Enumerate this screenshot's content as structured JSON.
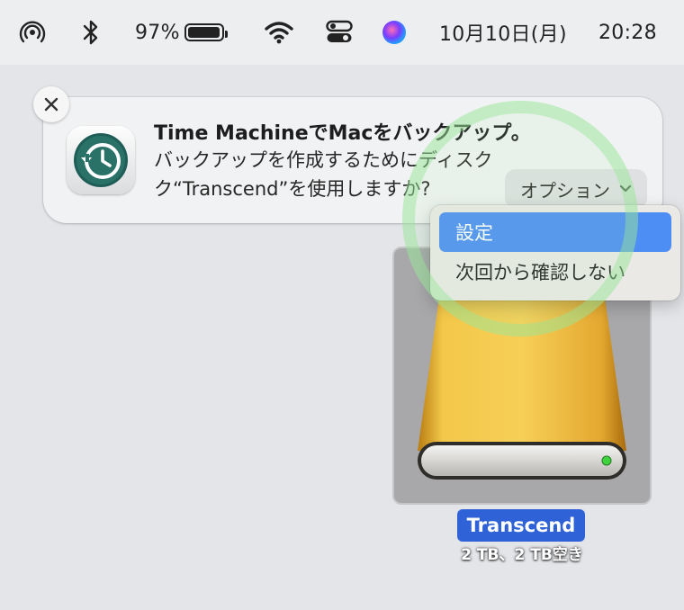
{
  "menubar": {
    "battery_percent": "97%",
    "battery_level": 0.97,
    "date": "10月10日(月)",
    "time": "20:28",
    "icons": [
      "airdrop-icon",
      "bluetooth-icon",
      "battery-icon",
      "wifi-icon",
      "control-center-icon",
      "siri-icon"
    ]
  },
  "notification": {
    "app_icon": "time-machine-icon",
    "title": "Time MachineでMacをバックアップ。",
    "body_line1": "バックアップを作成するためにディスク",
    "body_line2": "ク“Transcend”を使用しますか?",
    "options_label": "オプション",
    "close_icon": "close-icon"
  },
  "options_menu": {
    "items": [
      {
        "label": "設定",
        "selected": true
      },
      {
        "label": "次回から確認しない",
        "selected": false
      }
    ],
    "highlight_color": "#4d8ef5"
  },
  "desktop": {
    "disk": {
      "name": "Transcend",
      "info": "2 TB、2 TB空き",
      "icon": "external-drive-icon"
    }
  }
}
